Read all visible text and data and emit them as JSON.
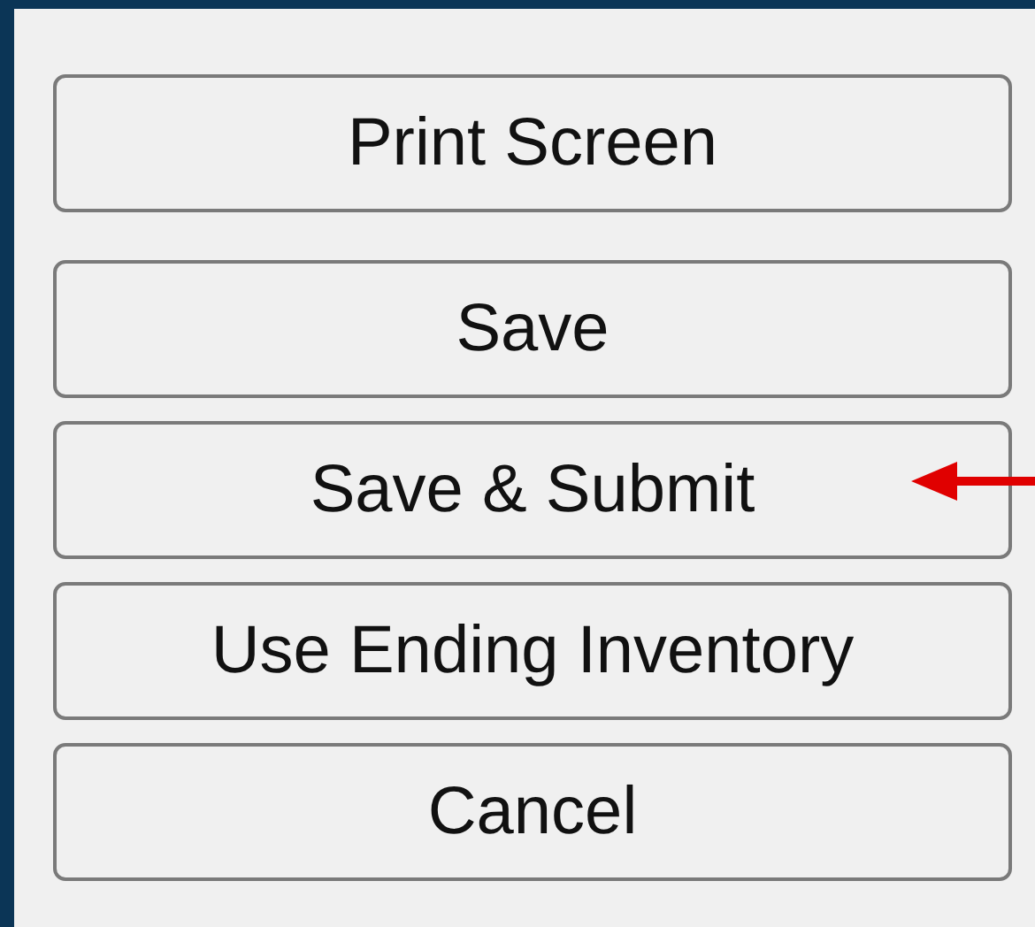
{
  "buttons": [
    {
      "label": "Print Screen",
      "arrow": false
    },
    {
      "label": "Save",
      "arrow": false
    },
    {
      "label": "Save & Submit",
      "arrow": true
    },
    {
      "label": "Use Ending Inventory",
      "arrow": false
    },
    {
      "label": "Cancel",
      "arrow": false
    }
  ]
}
